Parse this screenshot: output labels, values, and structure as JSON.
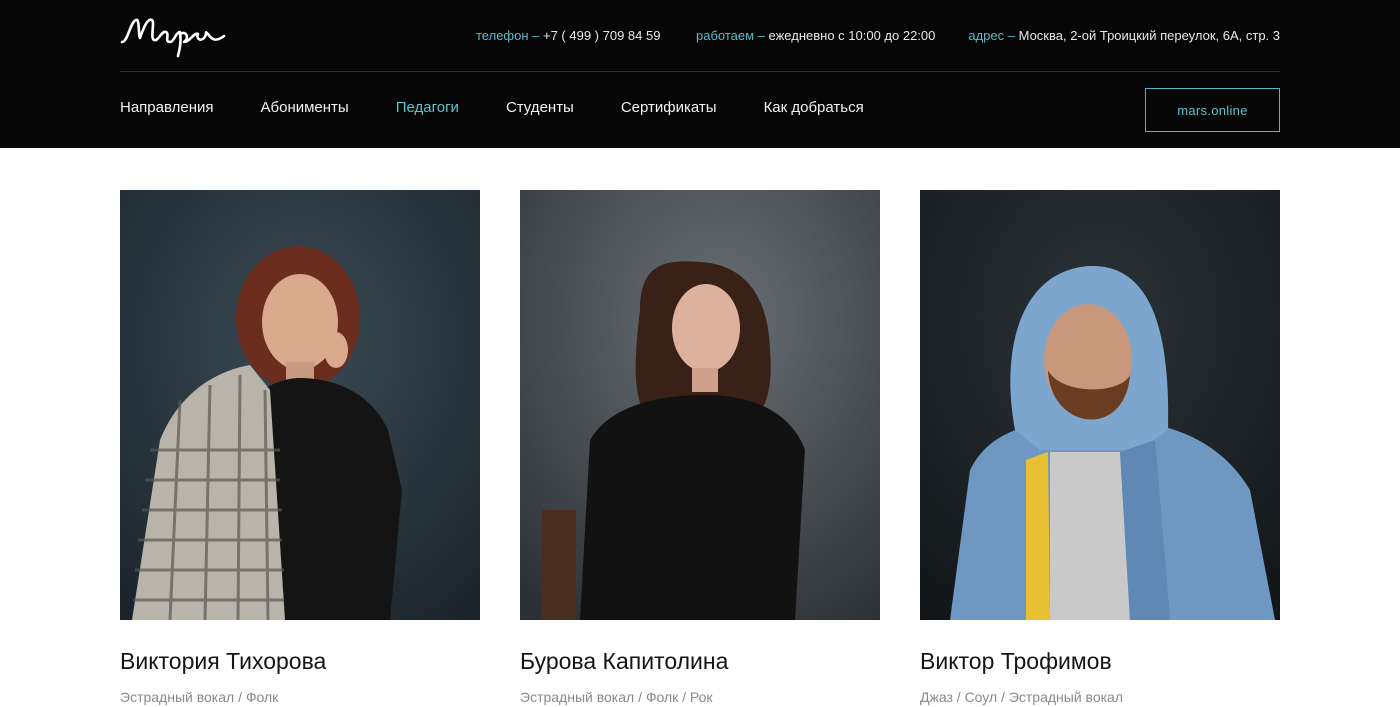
{
  "header": {
    "logo_text": "Марс",
    "contacts": [
      {
        "label": "телефон –",
        "value": "+7 ( 499 ) 709 84 59"
      },
      {
        "label": "работаем –",
        "value": "ежедневно с 10:00 до 22:00"
      },
      {
        "label": "адрес –",
        "value": "Москва, 2-ой Троицкий переулок, 6А, стр. 3"
      }
    ],
    "nav": [
      {
        "label": "Направления",
        "active": false
      },
      {
        "label": "Абонименты",
        "active": false
      },
      {
        "label": "Педагоги",
        "active": true
      },
      {
        "label": "Студенты",
        "active": false
      },
      {
        "label": "Сертификаты",
        "active": false
      },
      {
        "label": "Как добраться",
        "active": false
      }
    ],
    "online_button": "mars.online"
  },
  "colors": {
    "header_bg": "#060606",
    "accent": "#5fc3cc",
    "muted_text": "#8a8a8a"
  },
  "teachers": [
    {
      "name": "Виктория Тихорова",
      "tags": "Эстрадный вокал / Фолк",
      "photo_icon": "teacher-photo"
    },
    {
      "name": "Бурова Капитолина",
      "tags": "Эстрадный вокал / Фолк / Рок",
      "photo_icon": "teacher-photo"
    },
    {
      "name": "Виктор Трофимов",
      "tags": "Джаз / Соул / Эстрадный вокал",
      "photo_icon": "teacher-photo"
    }
  ]
}
